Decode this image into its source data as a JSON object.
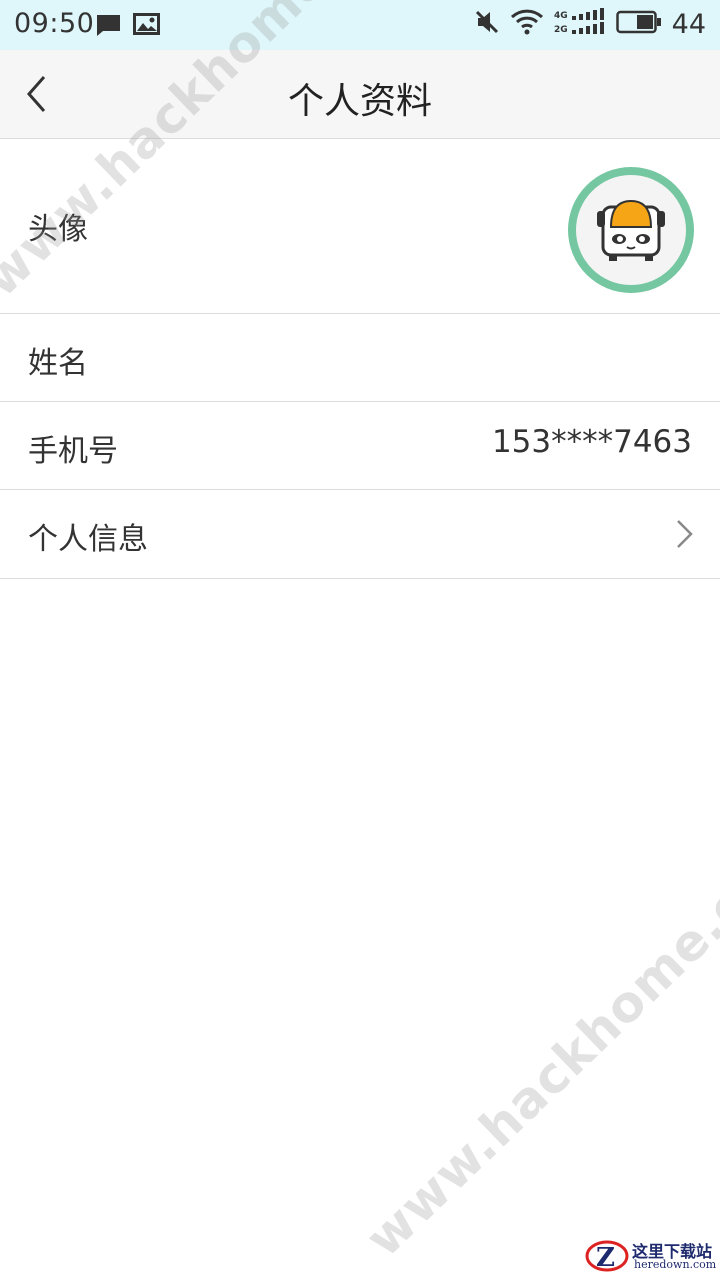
{
  "status_bar": {
    "time": "09:50",
    "battery_text": "44"
  },
  "header": {
    "title": "个人资料"
  },
  "profile_rows": {
    "avatar_label": "头像",
    "name_label": "姓名",
    "phone_label": "手机号",
    "phone_value": "153****7463",
    "info_label": "个人信息"
  },
  "watermark": {
    "text": "www.hackhome.com"
  },
  "site_logo": {
    "cn": "这里下载站",
    "en": "heredown.com"
  },
  "colors": {
    "status_bar_bg": "#dff7fb",
    "title_bar_bg": "#f6f6f6",
    "avatar_ring": "#74c7a0",
    "divider": "#dcdcdc"
  }
}
